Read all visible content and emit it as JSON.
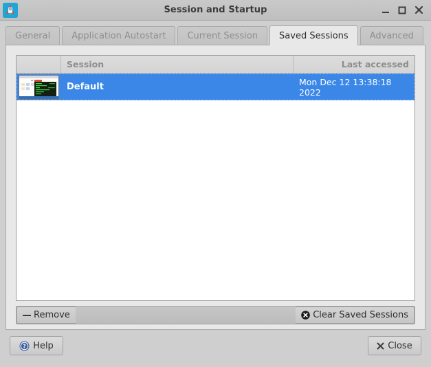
{
  "window": {
    "title": "Session and Startup",
    "icon": "rocket-app-icon",
    "controls": {
      "minimize": "minimize-icon",
      "maximize": "maximize-icon",
      "close": "close-icon"
    }
  },
  "tabs": [
    {
      "label": "General",
      "active": false
    },
    {
      "label": "Application Autostart",
      "active": false
    },
    {
      "label": "Current Session",
      "active": false
    },
    {
      "label": "Saved Sessions",
      "active": true
    },
    {
      "label": "Advanced",
      "active": false
    }
  ],
  "session_list": {
    "columns": [
      {
        "key": "thumb",
        "label": ""
      },
      {
        "key": "session",
        "label": "Session"
      },
      {
        "key": "date",
        "label": "Last accessed"
      }
    ],
    "rows": [
      {
        "thumbnail": "desktop-screenshot-thumbnail",
        "session": "Default",
        "date": "Mon Dec 12 13:38:18 2022",
        "selected": true
      }
    ]
  },
  "list_toolbar": {
    "remove": {
      "label": "Remove",
      "icon": "minus-icon"
    },
    "clear": {
      "label": "Clear Saved Sessions",
      "icon": "circle-x-icon"
    }
  },
  "dialog_buttons": {
    "help": {
      "label": "Help",
      "icon": "help-circle-icon"
    },
    "close": {
      "label": "Close",
      "icon": "x-icon"
    }
  },
  "colors": {
    "selection_blue": "#3a87e8",
    "window_chrome": "#cfcfcf",
    "panel": "#e8e8e8",
    "list_background": "#ffffff",
    "header_text": "#8d8d8d",
    "accent_icon_blue": "#1ea7d6",
    "help_blue": "#3e5f9e"
  }
}
